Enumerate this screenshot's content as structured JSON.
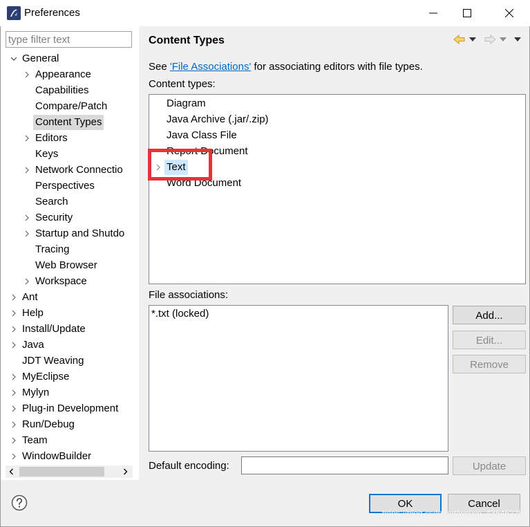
{
  "window": {
    "title": "Preferences"
  },
  "filter": {
    "placeholder": "type filter text"
  },
  "tree": [
    {
      "label": "General",
      "expanded": true,
      "children": [
        {
          "label": "Appearance",
          "has_children": true
        },
        {
          "label": "Capabilities",
          "has_children": false
        },
        {
          "label": "Compare/Patch",
          "has_children": false
        },
        {
          "label": "Content Types",
          "has_children": false,
          "selected": true
        },
        {
          "label": "Editors",
          "has_children": true
        },
        {
          "label": "Keys",
          "has_children": false
        },
        {
          "label": "Network Connectio",
          "has_children": true
        },
        {
          "label": "Perspectives",
          "has_children": false
        },
        {
          "label": "Search",
          "has_children": false
        },
        {
          "label": "Security",
          "has_children": true
        },
        {
          "label": "Startup and Shutdo",
          "has_children": true
        },
        {
          "label": "Tracing",
          "has_children": false
        },
        {
          "label": "Web Browser",
          "has_children": false
        },
        {
          "label": "Workspace",
          "has_children": true
        }
      ]
    },
    {
      "label": "Ant",
      "has_children": true
    },
    {
      "label": "Help",
      "has_children": true
    },
    {
      "label": "Install/Update",
      "has_children": true
    },
    {
      "label": "Java",
      "has_children": true
    },
    {
      "label": "JDT Weaving",
      "has_children": false
    },
    {
      "label": "MyEclipse",
      "has_children": true
    },
    {
      "label": "Mylyn",
      "has_children": true
    },
    {
      "label": "Plug-in Development",
      "has_children": true
    },
    {
      "label": "Run/Debug",
      "has_children": true
    },
    {
      "label": "Team",
      "has_children": true
    },
    {
      "label": "WindowBuilder",
      "has_children": true
    }
  ],
  "page": {
    "title": "Content Types",
    "see_prefix": "See ",
    "see_link": "'File Associations'",
    "see_suffix": " for associating editors with file types.",
    "content_types_label": "Content types:",
    "content_types": [
      {
        "label": "Diagram",
        "expandable": false
      },
      {
        "label": "Java Archive (.jar/.zip)",
        "expandable": false
      },
      {
        "label": "Java Class File",
        "expandable": false
      },
      {
        "label": "Report Document",
        "expandable": false
      },
      {
        "label": "Text",
        "expandable": true,
        "highlighted": true
      },
      {
        "label": "Word Document",
        "expandable": false
      }
    ],
    "file_associations_label": "File associations:",
    "file_associations": [
      "*.txt (locked)"
    ],
    "buttons": {
      "add": "Add...",
      "edit": "Edit...",
      "remove": "Remove"
    },
    "default_encoding_label": "Default encoding:",
    "default_encoding_value": "",
    "update_button": "Update"
  },
  "footer": {
    "ok": "OK",
    "cancel": "Cancel"
  },
  "watermark": "https://blog.csdn.net/weixin_43545225",
  "colors": {
    "accent": "#0078d7",
    "link": "#0066cc",
    "highlight_box": "#e8313b",
    "selection": "#d9d9d9",
    "list_highlight": "#cce8ff"
  }
}
